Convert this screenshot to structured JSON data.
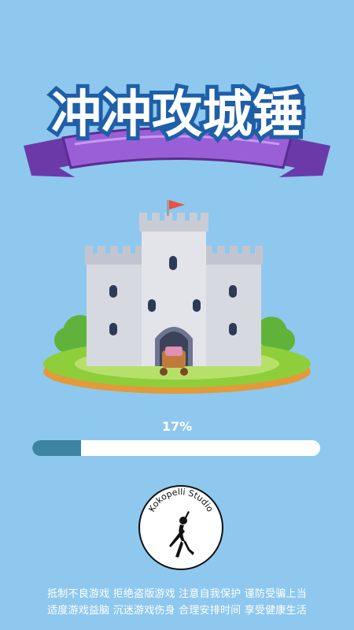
{
  "game": {
    "title": "冲冲攻城锤"
  },
  "loading": {
    "percent_label": "17%",
    "progress": 0.17
  },
  "studio": {
    "name": "Kokopelli Studio"
  },
  "health_notice": {
    "line1": "抵制不良游戏 拒绝盗版游戏 注意自我保护 谨防受骗上当",
    "line2": "适度游戏益脑 沉迷游戏伤身 合理安排时间 享受健康生活"
  },
  "colors": {
    "background": "#8ec8ee",
    "progress_fill": "#3d84a3",
    "progress_track": "#ffffff",
    "ribbon": "#8e4fc9",
    "grass": "#8fce3b"
  }
}
